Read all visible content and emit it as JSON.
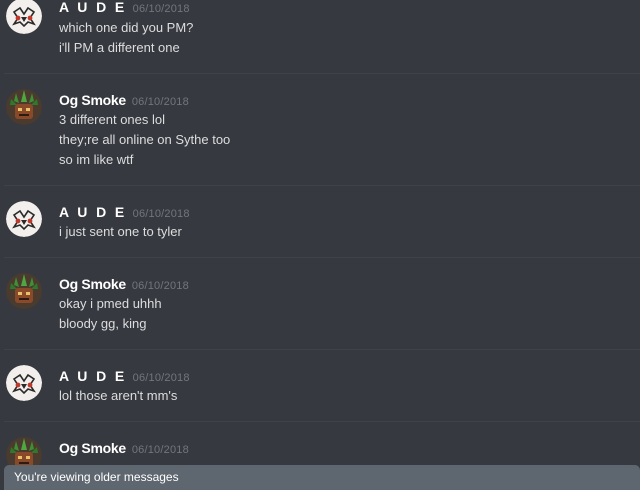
{
  "messages": [
    {
      "author": "A U D E",
      "timestamp": "06/10/2018",
      "lines": [
        "which one did you PM?",
        "i'll PM a different one"
      ]
    },
    {
      "author": "Og Smoke",
      "timestamp": "06/10/2018",
      "lines": [
        "3 different ones lol",
        "they;re all online on Sythe too",
        "so im like wtf"
      ]
    },
    {
      "author": "A U D E",
      "timestamp": "06/10/2018",
      "lines": [
        "i just sent one to tyler"
      ]
    },
    {
      "author": "Og Smoke",
      "timestamp": "06/10/2018",
      "lines": [
        "okay i pmed uhhh",
        "bloody gg, king"
      ]
    },
    {
      "author": "A U D E",
      "timestamp": "06/10/2018",
      "lines": [
        "lol those aren't mm's"
      ]
    },
    {
      "author": "Og Smoke",
      "timestamp": "06/10/2018",
      "lines": []
    }
  ],
  "older_messages_bar": {
    "label": "You're viewing older messages"
  },
  "colors": {
    "background": "#36393f",
    "username": "#ffffff",
    "timestamp": "#72767d",
    "message_text": "#dcddde",
    "older_bar": "#5e6770"
  },
  "icons": {
    "aude_avatar": "aude-avatar-icon",
    "og_smoke_avatar": "og-smoke-avatar-icon"
  }
}
